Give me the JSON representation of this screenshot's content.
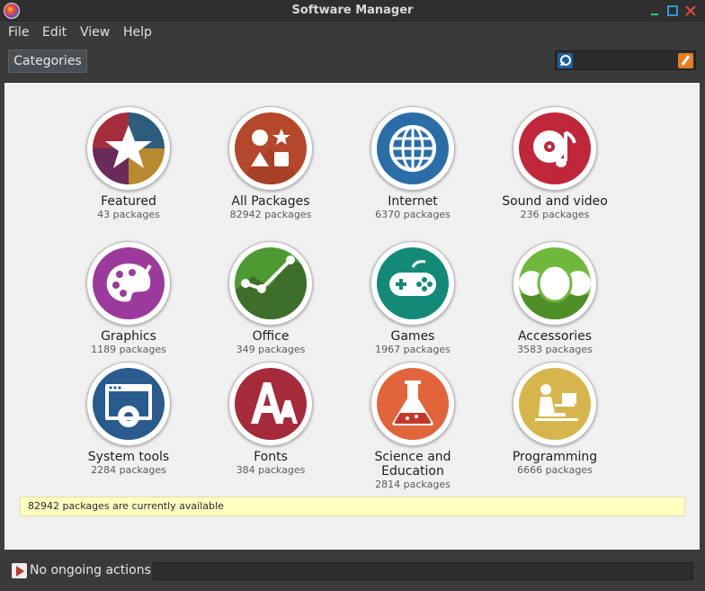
{
  "window": {
    "title": "Software Manager"
  },
  "menu": [
    {
      "label": "File"
    },
    {
      "label": "Edit"
    },
    {
      "label": "View"
    },
    {
      "label": "Help"
    }
  ],
  "toolbar": {
    "categories_label": "Categories",
    "search_value": ""
  },
  "categories": [
    {
      "name": "Featured",
      "count": "43 packages",
      "color": "#8e2f4f",
      "icon": "star-icon"
    },
    {
      "name": "All Packages",
      "count": "82942 packages",
      "color": "#b5472a",
      "icon": "shapes-icon"
    },
    {
      "name": "Internet",
      "count": "6370 packages",
      "color": "#2b6ea7",
      "icon": "globe-icon"
    },
    {
      "name": "Sound and video",
      "count": "236 packages",
      "color": "#c0273a",
      "icon": "music-disc-icon"
    },
    {
      "name": "Graphics",
      "count": "1189 packages",
      "color": "#9b3a9c",
      "icon": "palette-icon"
    },
    {
      "name": "Office",
      "count": "349 packages",
      "color": "#4e9a32",
      "icon": "line-chart-icon"
    },
    {
      "name": "Games",
      "count": "1967 packages",
      "color": "#138a78",
      "icon": "gamepad-icon"
    },
    {
      "name": "Accessories",
      "count": "3583 packages",
      "color": "#6fb83b",
      "icon": "accessories-icon"
    },
    {
      "name": "System tools",
      "count": "2284 packages",
      "color": "#2a5a8e",
      "icon": "gear-window-icon"
    },
    {
      "name": "Fonts",
      "count": "384 packages",
      "color": "#a52a3a",
      "icon": "fonts-icon"
    },
    {
      "name": "Science and Education",
      "count": "2814 packages",
      "color": "#e2643a",
      "icon": "flask-icon"
    },
    {
      "name": "Programming",
      "count": "6666 packages",
      "color": "#d7b54d",
      "icon": "programmer-icon"
    }
  ],
  "info_bar": "82942 packages are currently available",
  "bottom": {
    "actions_label": "No ongoing actions"
  }
}
